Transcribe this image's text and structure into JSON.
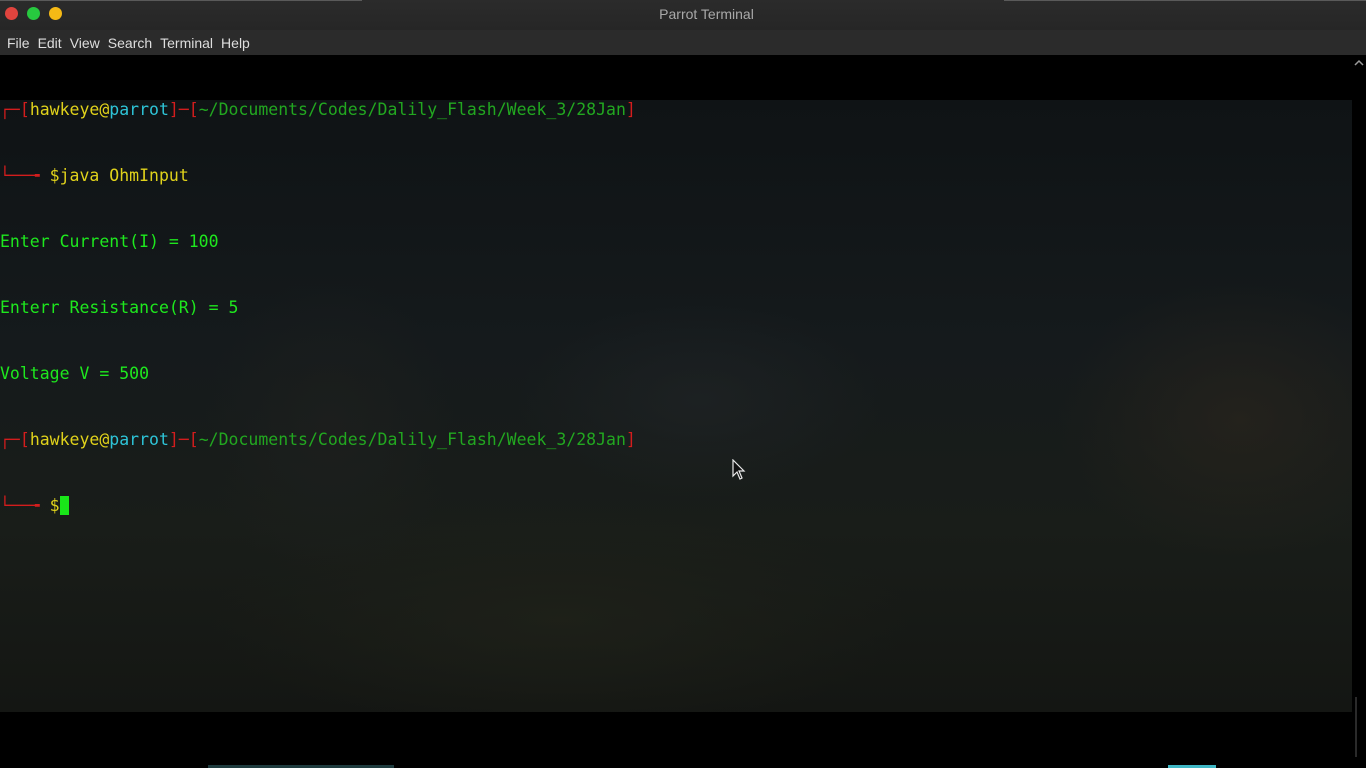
{
  "window": {
    "title": "Parrot Terminal"
  },
  "menu": [
    "File",
    "Edit",
    "View",
    "Search",
    "Terminal",
    "Help"
  ],
  "prompt": {
    "user": "hawkeye",
    "at": "@",
    "host": "parrot",
    "path": "~/Documents/Codes/Dalily_Flash/Week_3/28Jan",
    "symbol": "$"
  },
  "command": "java OhmInput",
  "output": [
    "Enter Current(I) = 100",
    "Enterr Resistance(R) = 5",
    "Voltage V = 500"
  ],
  "colors": {
    "prompt_bracket": "#d31d1d",
    "user": "#e0d21b",
    "host": "#2ec5d8",
    "path": "#22a720",
    "output": "#1ee81e",
    "cursor": "#19e619"
  },
  "icons": {
    "close": "close-icon",
    "maximize": "maximize-icon",
    "minimize": "minimize-icon",
    "scroll_up": "chevron-up-icon",
    "pointer": "mouse-pointer-icon"
  }
}
